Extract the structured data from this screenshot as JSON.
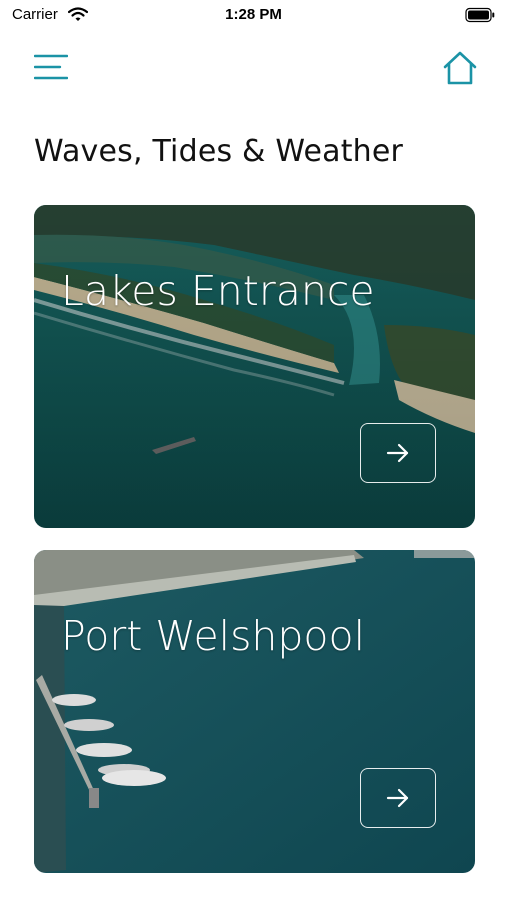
{
  "status_bar": {
    "carrier": "Carrier",
    "time": "1:28 PM",
    "wifi_icon": "wifi-icon",
    "battery_icon": "battery-icon"
  },
  "header": {
    "menu_icon": "hamburger-menu-icon",
    "home_icon": "home-icon",
    "accent_color": "#1b93a6"
  },
  "page": {
    "title": "Waves, Tides & Weather"
  },
  "locations": [
    {
      "name": "Lakes Entrance",
      "arrow_icon": "arrow-right-icon"
    },
    {
      "name": "Port Welshpool",
      "arrow_icon": "arrow-right-icon"
    }
  ]
}
